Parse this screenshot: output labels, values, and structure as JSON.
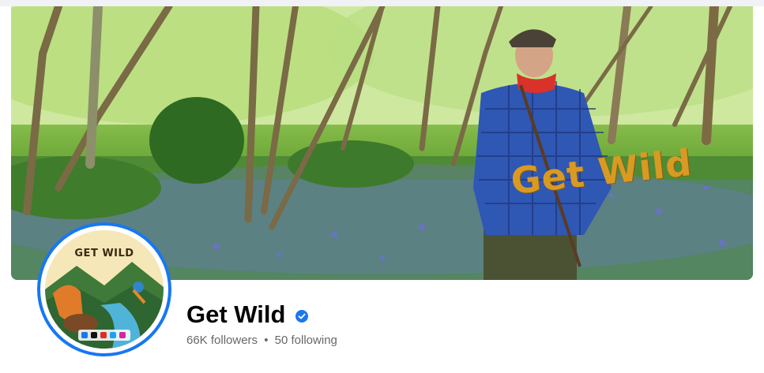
{
  "profile": {
    "name": "Get Wild",
    "verified": true,
    "followers": "66K followers",
    "separator": "•",
    "following": "50 following"
  },
  "cover": {
    "overlay_text": "Get Wild",
    "overlay_color": "#d99a23"
  },
  "avatar": {
    "logo_text": "GET WILD",
    "ring_color": "#1877f2",
    "social_icons": [
      "facebook-icon",
      "tiktok-icon",
      "youtube-icon",
      "twitter-icon",
      "instagram-icon"
    ]
  },
  "colors": {
    "name": "#050505",
    "secondary_text": "#65676b",
    "verified_badge": "#1877f2"
  }
}
